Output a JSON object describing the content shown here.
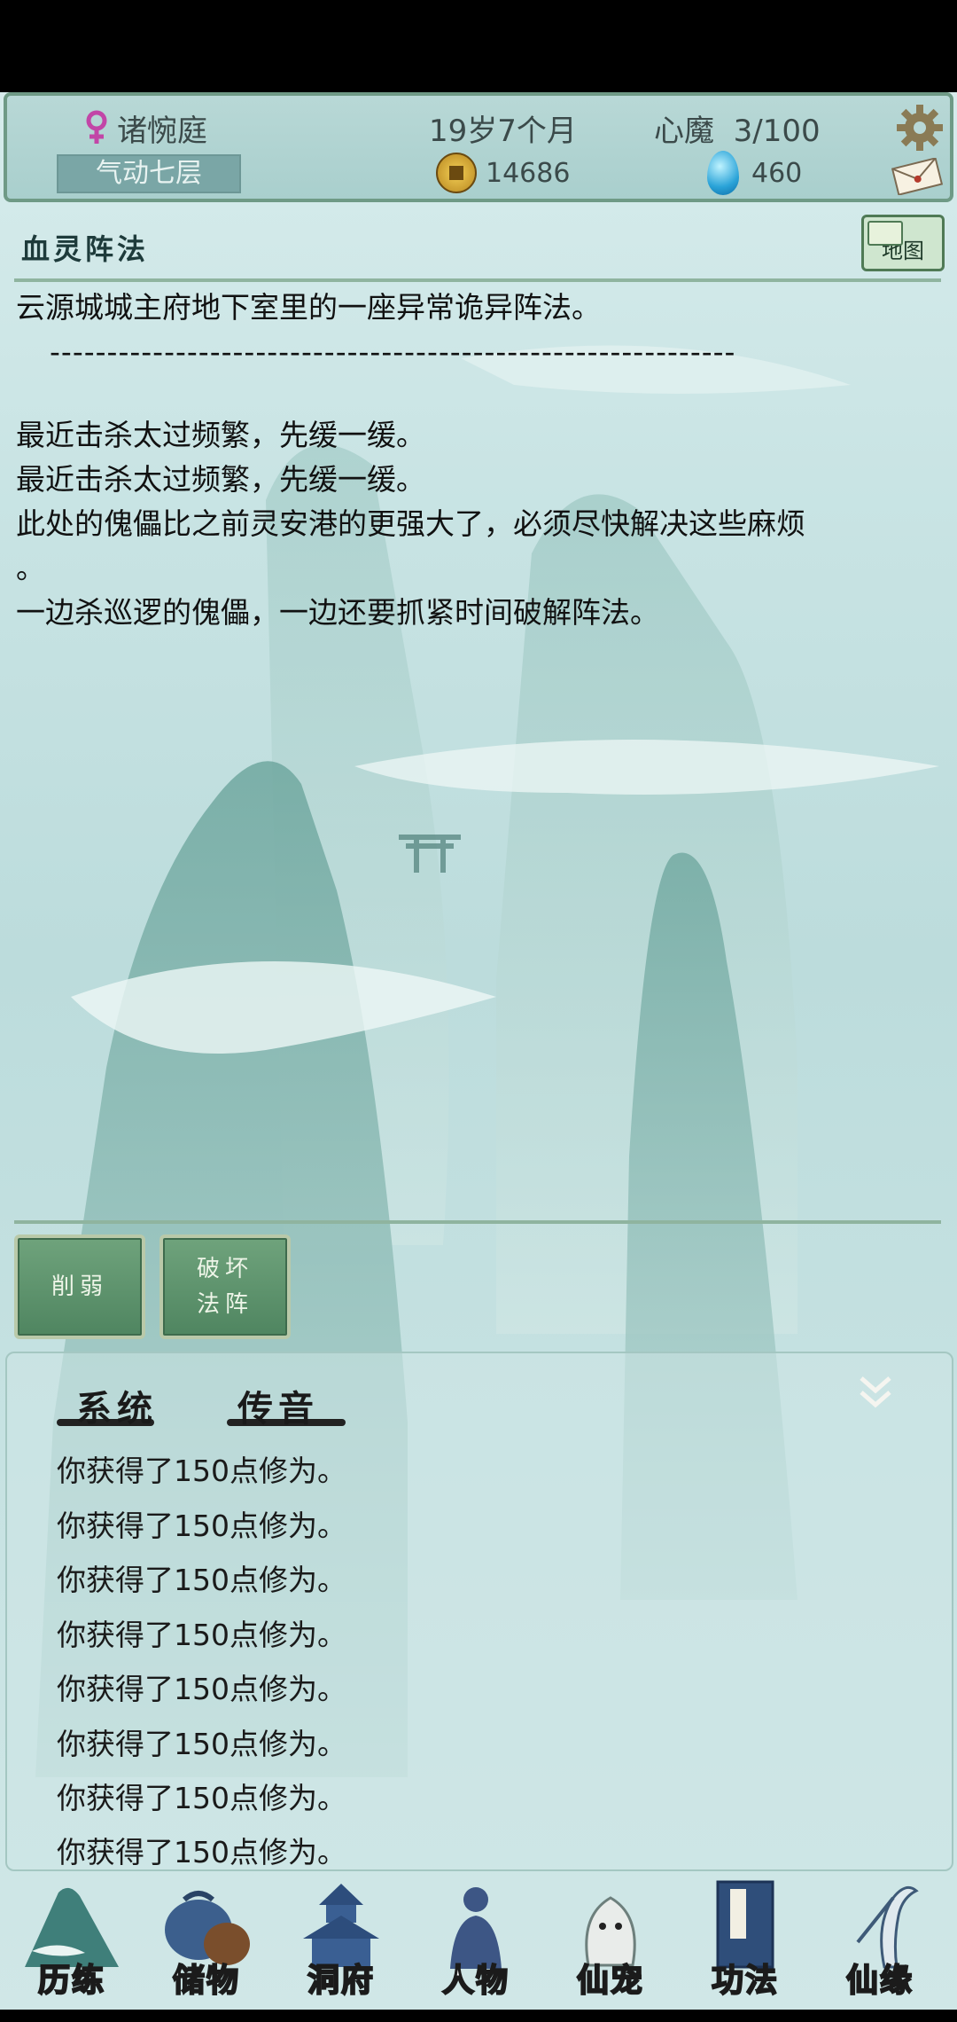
{
  "header": {
    "name": "诸惋庭",
    "realm": "气动七层",
    "age": "19岁7个月",
    "heart_demon": "心魔  3/100",
    "coins": "14686",
    "gems": "460"
  },
  "location": {
    "title": "血灵阵法",
    "map_label": "地图",
    "desc_lines": [
      "云源城城主府地下室里的一座异常诡异阵法。",
      "------------------------------------------------------------",
      "",
      "最近击杀太过频繁，先缓一缓。",
      "最近击杀太过频繁，先缓一缓。",
      "此处的傀儡比之前灵安港的更强大了，必须尽快解决这些麻烦",
      "。",
      "一边杀巡逻的傀儡，一边还要抓紧时间破解阵法。"
    ]
  },
  "actions": [
    {
      "label": "削弱"
    },
    {
      "label": "破坏\n法阵"
    }
  ],
  "log": {
    "tabs": [
      "系统",
      "传音"
    ],
    "items": [
      "你获得了150点修为。",
      "你获得了150点修为。",
      "你获得了150点修为。",
      "你获得了150点修为。",
      "你获得了150点修为。",
      "你获得了150点修为。",
      "你获得了150点修为。",
      "你获得了150点修为。"
    ]
  },
  "nav": [
    "历练",
    "储物",
    "洞府",
    "人物",
    "仙宠",
    "功法",
    "仙缘"
  ]
}
